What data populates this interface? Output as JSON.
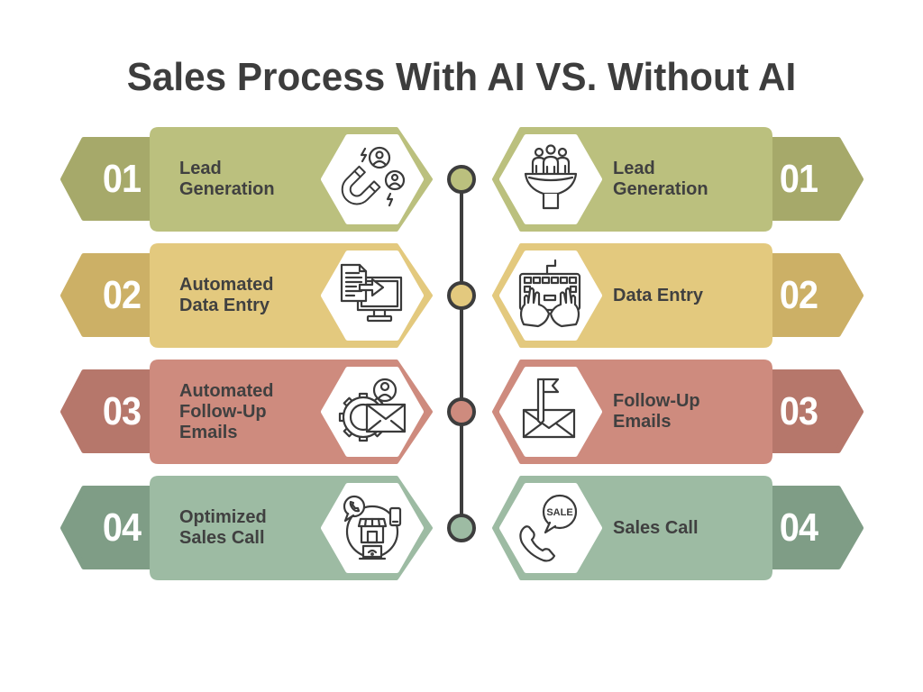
{
  "title": "Sales Process With AI VS. Without AI",
  "palette": {
    "text": "#404040",
    "timeline": "#3D3D3D",
    "number_text": "#FFFFFF",
    "icon_bg": "#FFFFFF"
  },
  "with_ai": {
    "steps": [
      {
        "number": "01",
        "label_lines": [
          "Lead",
          "Generation"
        ],
        "icon": "magnet-leads-icon",
        "card_color": "#BBC07E",
        "tab_color": "#A6A96A"
      },
      {
        "number": "02",
        "label_lines": [
          "Automated",
          "Data Entry"
        ],
        "icon": "document-to-monitor-icon",
        "card_color": "#E3C97E",
        "tab_color": "#CCB066"
      },
      {
        "number": "03",
        "label_lines": [
          "Automated",
          "Follow-Up",
          "Emails"
        ],
        "icon": "gear-email-user-icon",
        "card_color": "#CE8B7E",
        "tab_color": "#B6776B"
      },
      {
        "number": "04",
        "label_lines": [
          "Optimized",
          "Sales Call"
        ],
        "icon": "omnichannel-store-icon",
        "card_color": "#9DBBA3",
        "tab_color": "#7F9D86"
      }
    ]
  },
  "without_ai": {
    "steps": [
      {
        "number": "01",
        "label_lines": [
          "Lead",
          "Generation"
        ],
        "icon": "funnel-people-icon",
        "card_color": "#BBC07E",
        "tab_color": "#A6A96A"
      },
      {
        "number": "02",
        "label_lines": [
          "Data Entry"
        ],
        "icon": "keyboard-hands-icon",
        "card_color": "#E3C97E",
        "tab_color": "#CCB066"
      },
      {
        "number": "03",
        "label_lines": [
          "Follow-Up",
          "Emails"
        ],
        "icon": "envelope-flag-icon",
        "card_color": "#CE8B7E",
        "tab_color": "#B6776B"
      },
      {
        "number": "04",
        "label_lines": [
          "Sales Call"
        ],
        "icon": "phone-sale-icon",
        "icon_text": "SALE",
        "card_color": "#9DBBA3",
        "tab_color": "#7F9D86"
      }
    ]
  },
  "timeline": {
    "nodes": [
      {
        "color": "#BBC07E"
      },
      {
        "color": "#E3C97E"
      },
      {
        "color": "#CE8B7E"
      },
      {
        "color": "#9DBBA3"
      }
    ]
  }
}
